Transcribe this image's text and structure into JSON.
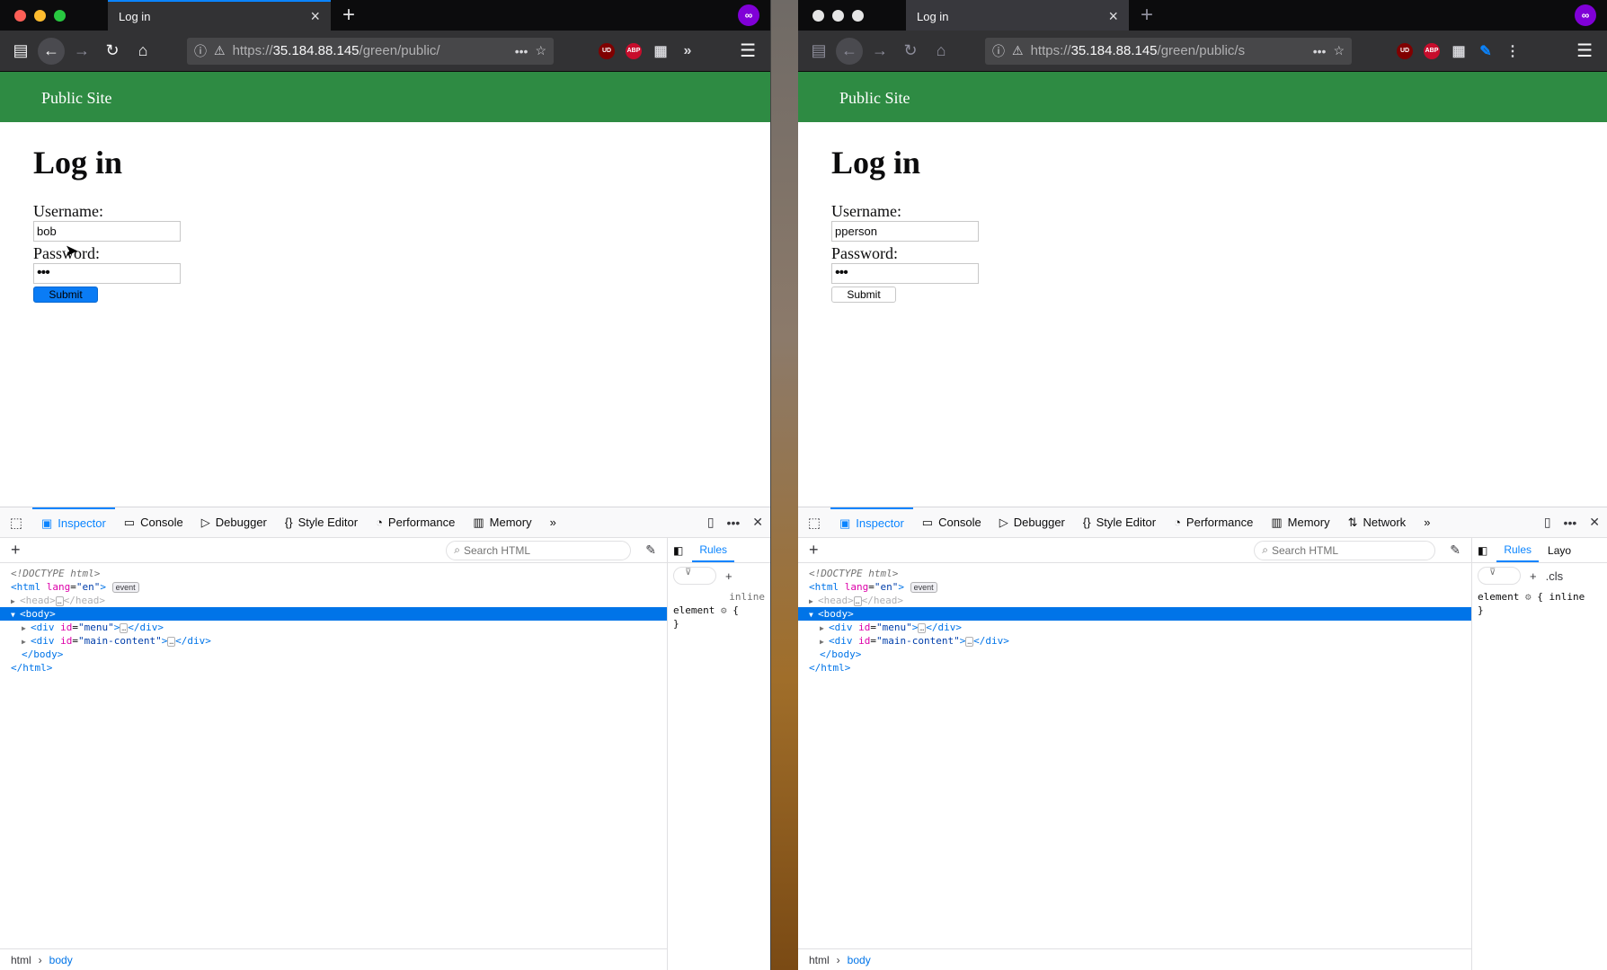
{
  "windows": [
    {
      "tab_title": "Log in",
      "url_display": "https://35.184.88.145/green/public/",
      "url_host": "35.184.88.145",
      "url_prefix": "https://",
      "url_suffix": "/green/public/",
      "site_title": "Public Site",
      "page_title": "Log in",
      "username_label": "Username:",
      "username_value": "bob",
      "password_label": "Password:",
      "password_value": "•••",
      "submit_label": "Submit",
      "devtools_tabs": [
        "Inspector",
        "Console",
        "Debugger",
        "Style Editor",
        "Performance",
        "Memory"
      ],
      "search_placeholder": "Search HTML",
      "sidebar_tabs": [
        "Rules"
      ],
      "rules_text": [
        "inline",
        "element",
        "{",
        "}"
      ],
      "breadcrumbs": [
        "html",
        "body"
      ]
    },
    {
      "tab_title": "Log in",
      "url_display": "https://35.184.88.145/green/public/s",
      "url_host": "35.184.88.145",
      "url_prefix": "https://",
      "url_suffix": "/green/public/s",
      "site_title": "Public Site",
      "page_title": "Log in",
      "username_label": "Username:",
      "username_value": "pperson",
      "password_label": "Password:",
      "password_value": "•••",
      "submit_label": "Submit",
      "devtools_tabs": [
        "Inspector",
        "Console",
        "Debugger",
        "Style Editor",
        "Performance",
        "Memory",
        "Network"
      ],
      "search_placeholder": "Search HTML",
      "sidebar_tabs": [
        "Rules",
        "Layo"
      ],
      "rules_text": [
        ".cls",
        "element",
        "{ inline",
        "}"
      ],
      "breadcrumbs": [
        "html",
        "body"
      ]
    }
  ],
  "markup_tree": {
    "doctype": "<!DOCTYPE html>",
    "html_open_tag": "<html",
    "html_lang_attr": "lang",
    "html_lang_val": "\"en\"",
    "event_badge": "event",
    "head_line": "<head>",
    "head_close": "</head>",
    "body_open": "<body>",
    "div_menu_id": "\"menu\"",
    "div_main_id": "\"main-content\"",
    "body_close": "</body>",
    "html_close": "</html>"
  },
  "icons": {
    "extensions": [
      "UD",
      "ABP"
    ],
    "private_mask": "∞"
  },
  "colors": {
    "site_green": "#2e8b43",
    "accent_blue": "#0a84ff",
    "selection_blue": "#0074e8"
  }
}
